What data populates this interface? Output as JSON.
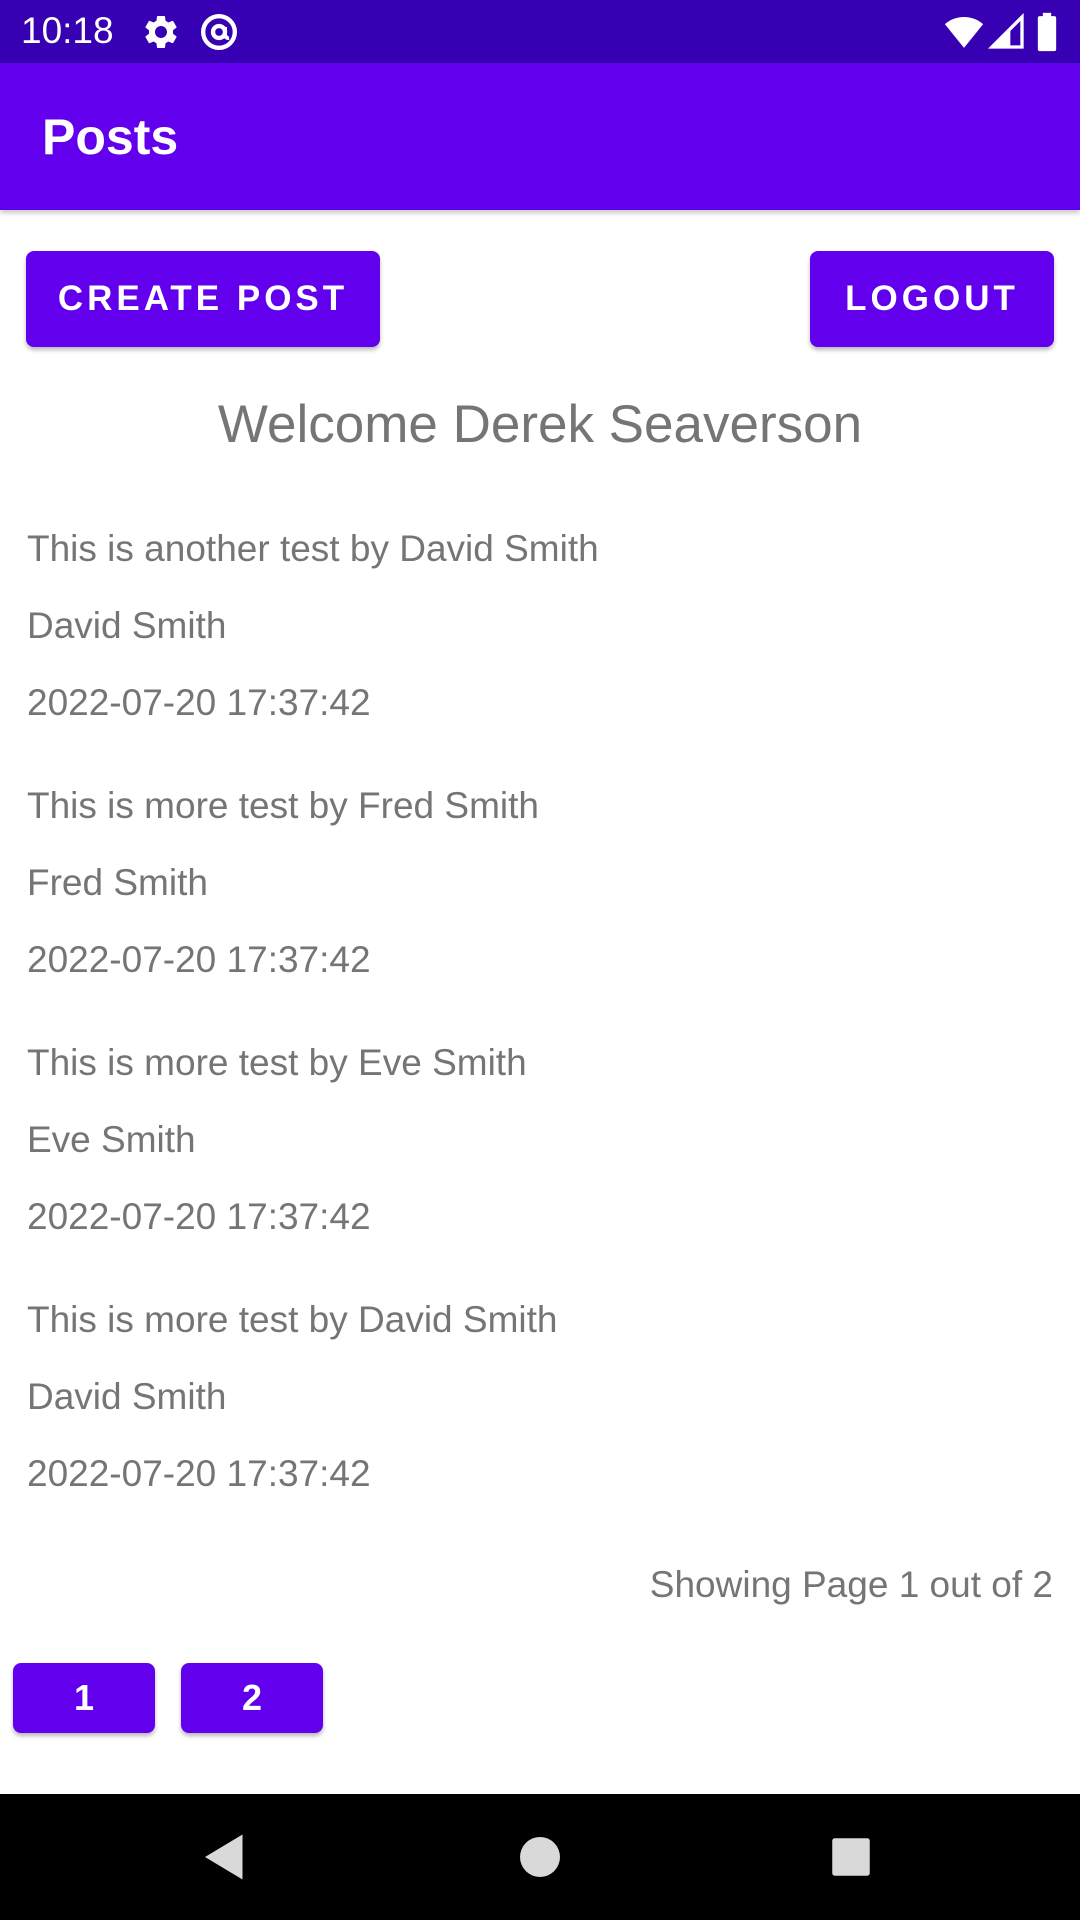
{
  "status_bar": {
    "time": "10:18",
    "icons": [
      "gear-icon",
      "at-sign-icon",
      "wifi-icon",
      "signal-icon",
      "battery-icon"
    ]
  },
  "app_bar": {
    "title": "Posts"
  },
  "actions": {
    "create_post_label": "CREATE POST",
    "logout_label": "LOGOUT"
  },
  "welcome_text": "Welcome Derek Seaverson",
  "posts": [
    {
      "content": "This is another test by David Smith",
      "author": "David Smith",
      "timestamp": "2022-07-20 17:37:42"
    },
    {
      "content": "This is more test by Fred Smith",
      "author": "Fred Smith",
      "timestamp": "2022-07-20 17:37:42"
    },
    {
      "content": "This is more test by Eve Smith",
      "author": "Eve Smith",
      "timestamp": "2022-07-20 17:37:42"
    },
    {
      "content": "This is more test by David Smith",
      "author": "David Smith",
      "timestamp": "2022-07-20 17:37:42"
    }
  ],
  "pagination": {
    "status_text": "Showing Page 1 out of 2",
    "pages": [
      "1",
      "2"
    ]
  },
  "nav_bar": {
    "icons": [
      "back-icon",
      "home-icon",
      "recents-icon"
    ]
  },
  "colors": {
    "status_bar": "#3700b3",
    "primary": "#6200ee",
    "text_secondary": "#757575",
    "nav_bar": "#000000"
  }
}
